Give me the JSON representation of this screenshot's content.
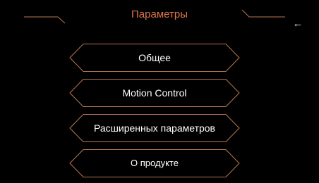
{
  "header": {
    "title": "Параметры",
    "back_icon": "back-arrow-icon",
    "back_glyph": "←"
  },
  "menu": {
    "items": [
      {
        "id": "general",
        "label": "Общее"
      },
      {
        "id": "motion-control",
        "label": "Motion Control"
      },
      {
        "id": "advanced",
        "label": "Расширенных параметров"
      },
      {
        "id": "about",
        "label": "О продукте"
      }
    ]
  },
  "colors": {
    "background": "#000000",
    "accent": "#e0754a",
    "outline": "#b9764f",
    "text": "#ffffff"
  }
}
